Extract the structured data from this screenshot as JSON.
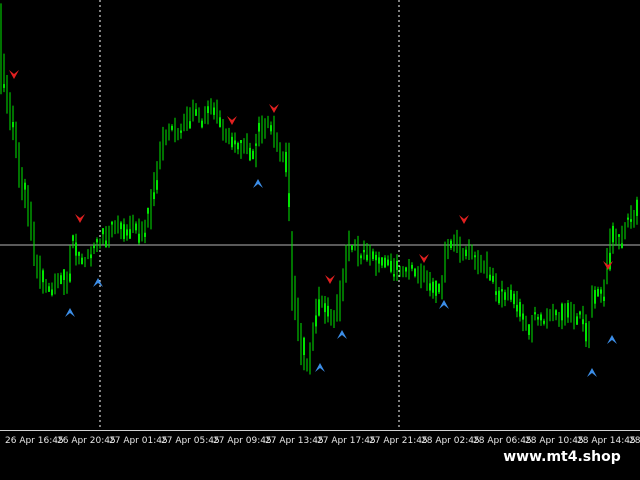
{
  "chart_data": {
    "type": "candlestick",
    "theme": {
      "background": "#000000",
      "candle": "#00e600",
      "grid": "#ffffff",
      "hline": "#b4b4b4",
      "sell_arrow": "#e02020",
      "buy_arrow": "#3c8ee8"
    },
    "time_labels": [
      "26 Apr 16:45",
      "26 Apr 20:45",
      "27 Apr 01:45",
      "27 Apr 05:45",
      "27 Apr 09:45",
      "27 Apr 13:45",
      "27 Apr 17:45",
      "27 Apr 21:45",
      "28 Apr 02:45",
      "28 Apr 06:45",
      "28 Apr 10:45",
      "28 Apr 14:45",
      "28 A"
    ],
    "price_path": [
      [
        0,
        40
      ],
      [
        6,
        90
      ],
      [
        14,
        130
      ],
      [
        22,
        180
      ],
      [
        30,
        215
      ],
      [
        36,
        260
      ],
      [
        44,
        285
      ],
      [
        52,
        290
      ],
      [
        60,
        275
      ],
      [
        68,
        285
      ],
      [
        72,
        240
      ],
      [
        78,
        255
      ],
      [
        86,
        260
      ],
      [
        94,
        250
      ],
      [
        102,
        240
      ],
      [
        110,
        235
      ],
      [
        118,
        225
      ],
      [
        126,
        230
      ],
      [
        134,
        220
      ],
      [
        142,
        235
      ],
      [
        150,
        215
      ],
      [
        156,
        180
      ],
      [
        162,
        145
      ],
      [
        170,
        130
      ],
      [
        178,
        135
      ],
      [
        186,
        120
      ],
      [
        194,
        110
      ],
      [
        202,
        120
      ],
      [
        210,
        105
      ],
      [
        216,
        110
      ],
      [
        222,
        125
      ],
      [
        230,
        140
      ],
      [
        238,
        150
      ],
      [
        246,
        145
      ],
      [
        254,
        160
      ],
      [
        260,
        130
      ],
      [
        268,
        125
      ],
      [
        274,
        135
      ],
      [
        280,
        155
      ],
      [
        286,
        160
      ],
      [
        288,
        150
      ],
      [
        292,
        270
      ],
      [
        298,
        320
      ],
      [
        302,
        350
      ],
      [
        308,
        370
      ],
      [
        314,
        330
      ],
      [
        320,
        300
      ],
      [
        326,
        310
      ],
      [
        334,
        320
      ],
      [
        340,
        300
      ],
      [
        348,
        250
      ],
      [
        354,
        245
      ],
      [
        360,
        260
      ],
      [
        366,
        250
      ],
      [
        372,
        255
      ],
      [
        380,
        265
      ],
      [
        388,
        262
      ],
      [
        396,
        270
      ],
      [
        404,
        275
      ],
      [
        412,
        270
      ],
      [
        420,
        275
      ],
      [
        428,
        280
      ],
      [
        436,
        290
      ],
      [
        442,
        285
      ],
      [
        446,
        250
      ],
      [
        452,
        240
      ],
      [
        458,
        245
      ],
      [
        464,
        255
      ],
      [
        470,
        250
      ],
      [
        476,
        265
      ],
      [
        482,
        260
      ],
      [
        488,
        270
      ],
      [
        494,
        280
      ],
      [
        500,
        295
      ],
      [
        506,
        300
      ],
      [
        512,
        290
      ],
      [
        518,
        310
      ],
      [
        524,
        320
      ],
      [
        530,
        330
      ],
      [
        536,
        315
      ],
      [
        544,
        320
      ],
      [
        552,
        315
      ],
      [
        560,
        318
      ],
      [
        568,
        310
      ],
      [
        576,
        322
      ],
      [
        582,
        312
      ],
      [
        588,
        345
      ],
      [
        592,
        300
      ],
      [
        598,
        295
      ],
      [
        604,
        290
      ],
      [
        610,
        250
      ],
      [
        614,
        230
      ],
      [
        620,
        240
      ],
      [
        626,
        225
      ],
      [
        632,
        220
      ],
      [
        640,
        200
      ]
    ],
    "sell_signals": [
      [
        14,
        74
      ],
      [
        80,
        218
      ],
      [
        232,
        120
      ],
      [
        274,
        108
      ],
      [
        330,
        279
      ],
      [
        424,
        258
      ],
      [
        464,
        219
      ],
      [
        608,
        265
      ]
    ],
    "buy_signals": [
      [
        70,
        313
      ],
      [
        98,
        283
      ],
      [
        258,
        184
      ],
      [
        342,
        335
      ],
      [
        320,
        368
      ],
      [
        444,
        305
      ],
      [
        592,
        373
      ],
      [
        612,
        340
      ]
    ],
    "ylim": [
      0,
      430
    ]
  },
  "watermark": "www.mt4.shop"
}
